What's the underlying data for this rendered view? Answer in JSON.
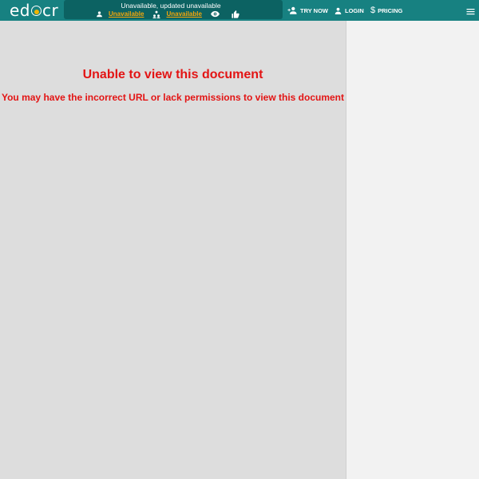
{
  "brand": {
    "logo_left": "ed",
    "logo_right": "cr",
    "colors": {
      "topbar": "#178181",
      "panel": "#0c6262",
      "accent": "#f4a60a",
      "error": "#e31414"
    }
  },
  "doc_info": {
    "status": "Unavailable, updated unavailable",
    "owner_label": "Unavailable",
    "group_label": "Unavailable",
    "owner_icon": "person-icon",
    "group_icon": "group-icon",
    "views_icon": "eye-icon",
    "like_icon": "thumbs-up-icon"
  },
  "nav": {
    "try_now": "TRY NOW",
    "login": "LOGIN",
    "pricing": "PRICING",
    "menu_icon": "hamburger-menu-icon"
  },
  "error": {
    "title": "Unable to view this document",
    "message": "You may have the incorrect URL or lack permissions to view this document"
  }
}
